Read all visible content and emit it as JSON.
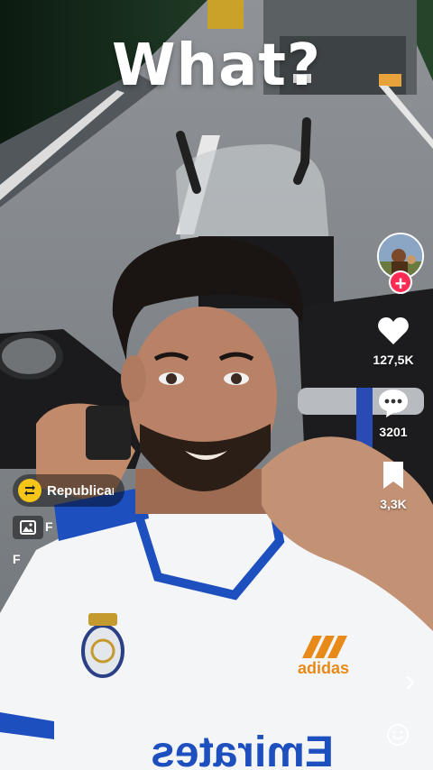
{
  "video": {
    "caption": "What?"
  },
  "rail": {
    "likes": "127,5K",
    "comments": "3201",
    "saves": "3,3K",
    "follow_symbol": "+"
  },
  "overlay": {
    "repost_label": "Republican",
    "sub_label": "F",
    "sub_label_2": "F"
  },
  "colors": {
    "follow": "#fe2c55",
    "repost_badge": "#f5c518"
  }
}
